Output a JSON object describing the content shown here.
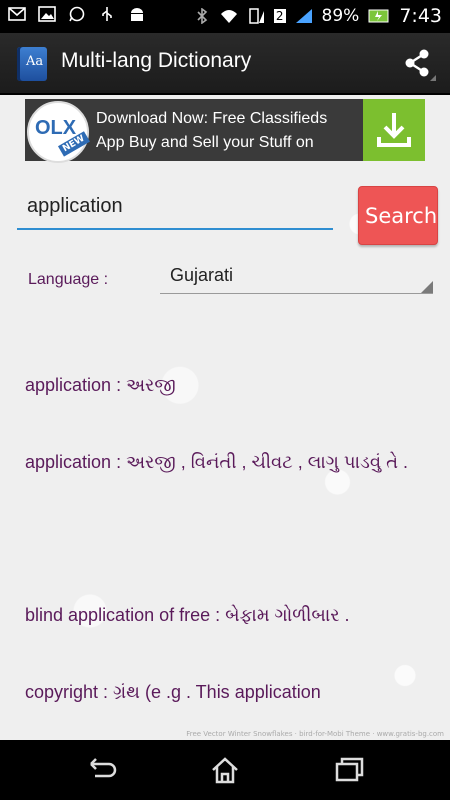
{
  "status_bar": {
    "left_icons": [
      "gmail-icon",
      "image-icon",
      "whatsapp-icon",
      "usb-icon",
      "android-icon"
    ],
    "sim_slot": "2",
    "battery": "89%",
    "time": "7:43"
  },
  "action_bar": {
    "app_icon_text": "Aa",
    "title": "Multi-lang Dictionary"
  },
  "ad": {
    "logo_text": "OLX",
    "logo_badge": "NEW",
    "text": "Download Now: Free Classifieds App Buy and Sell your Stuff on",
    "watermark": "Free Vector Winter Snowflakes · bird-for-Mobi Theme · www.gratis-bg.com"
  },
  "search": {
    "value": "application",
    "button_label": "Search"
  },
  "language": {
    "label": "Language :",
    "selected": "Gujarati"
  },
  "results": [
    "application : અરજી",
    "application : અરજી , વિનંતી , ચીવટ , લાગુ પાડવું તે .",
    "blind application of free : બેફામ ગોળીબાર .",
    "copyright : ગ્રંથ (e .g . This application"
  ]
}
